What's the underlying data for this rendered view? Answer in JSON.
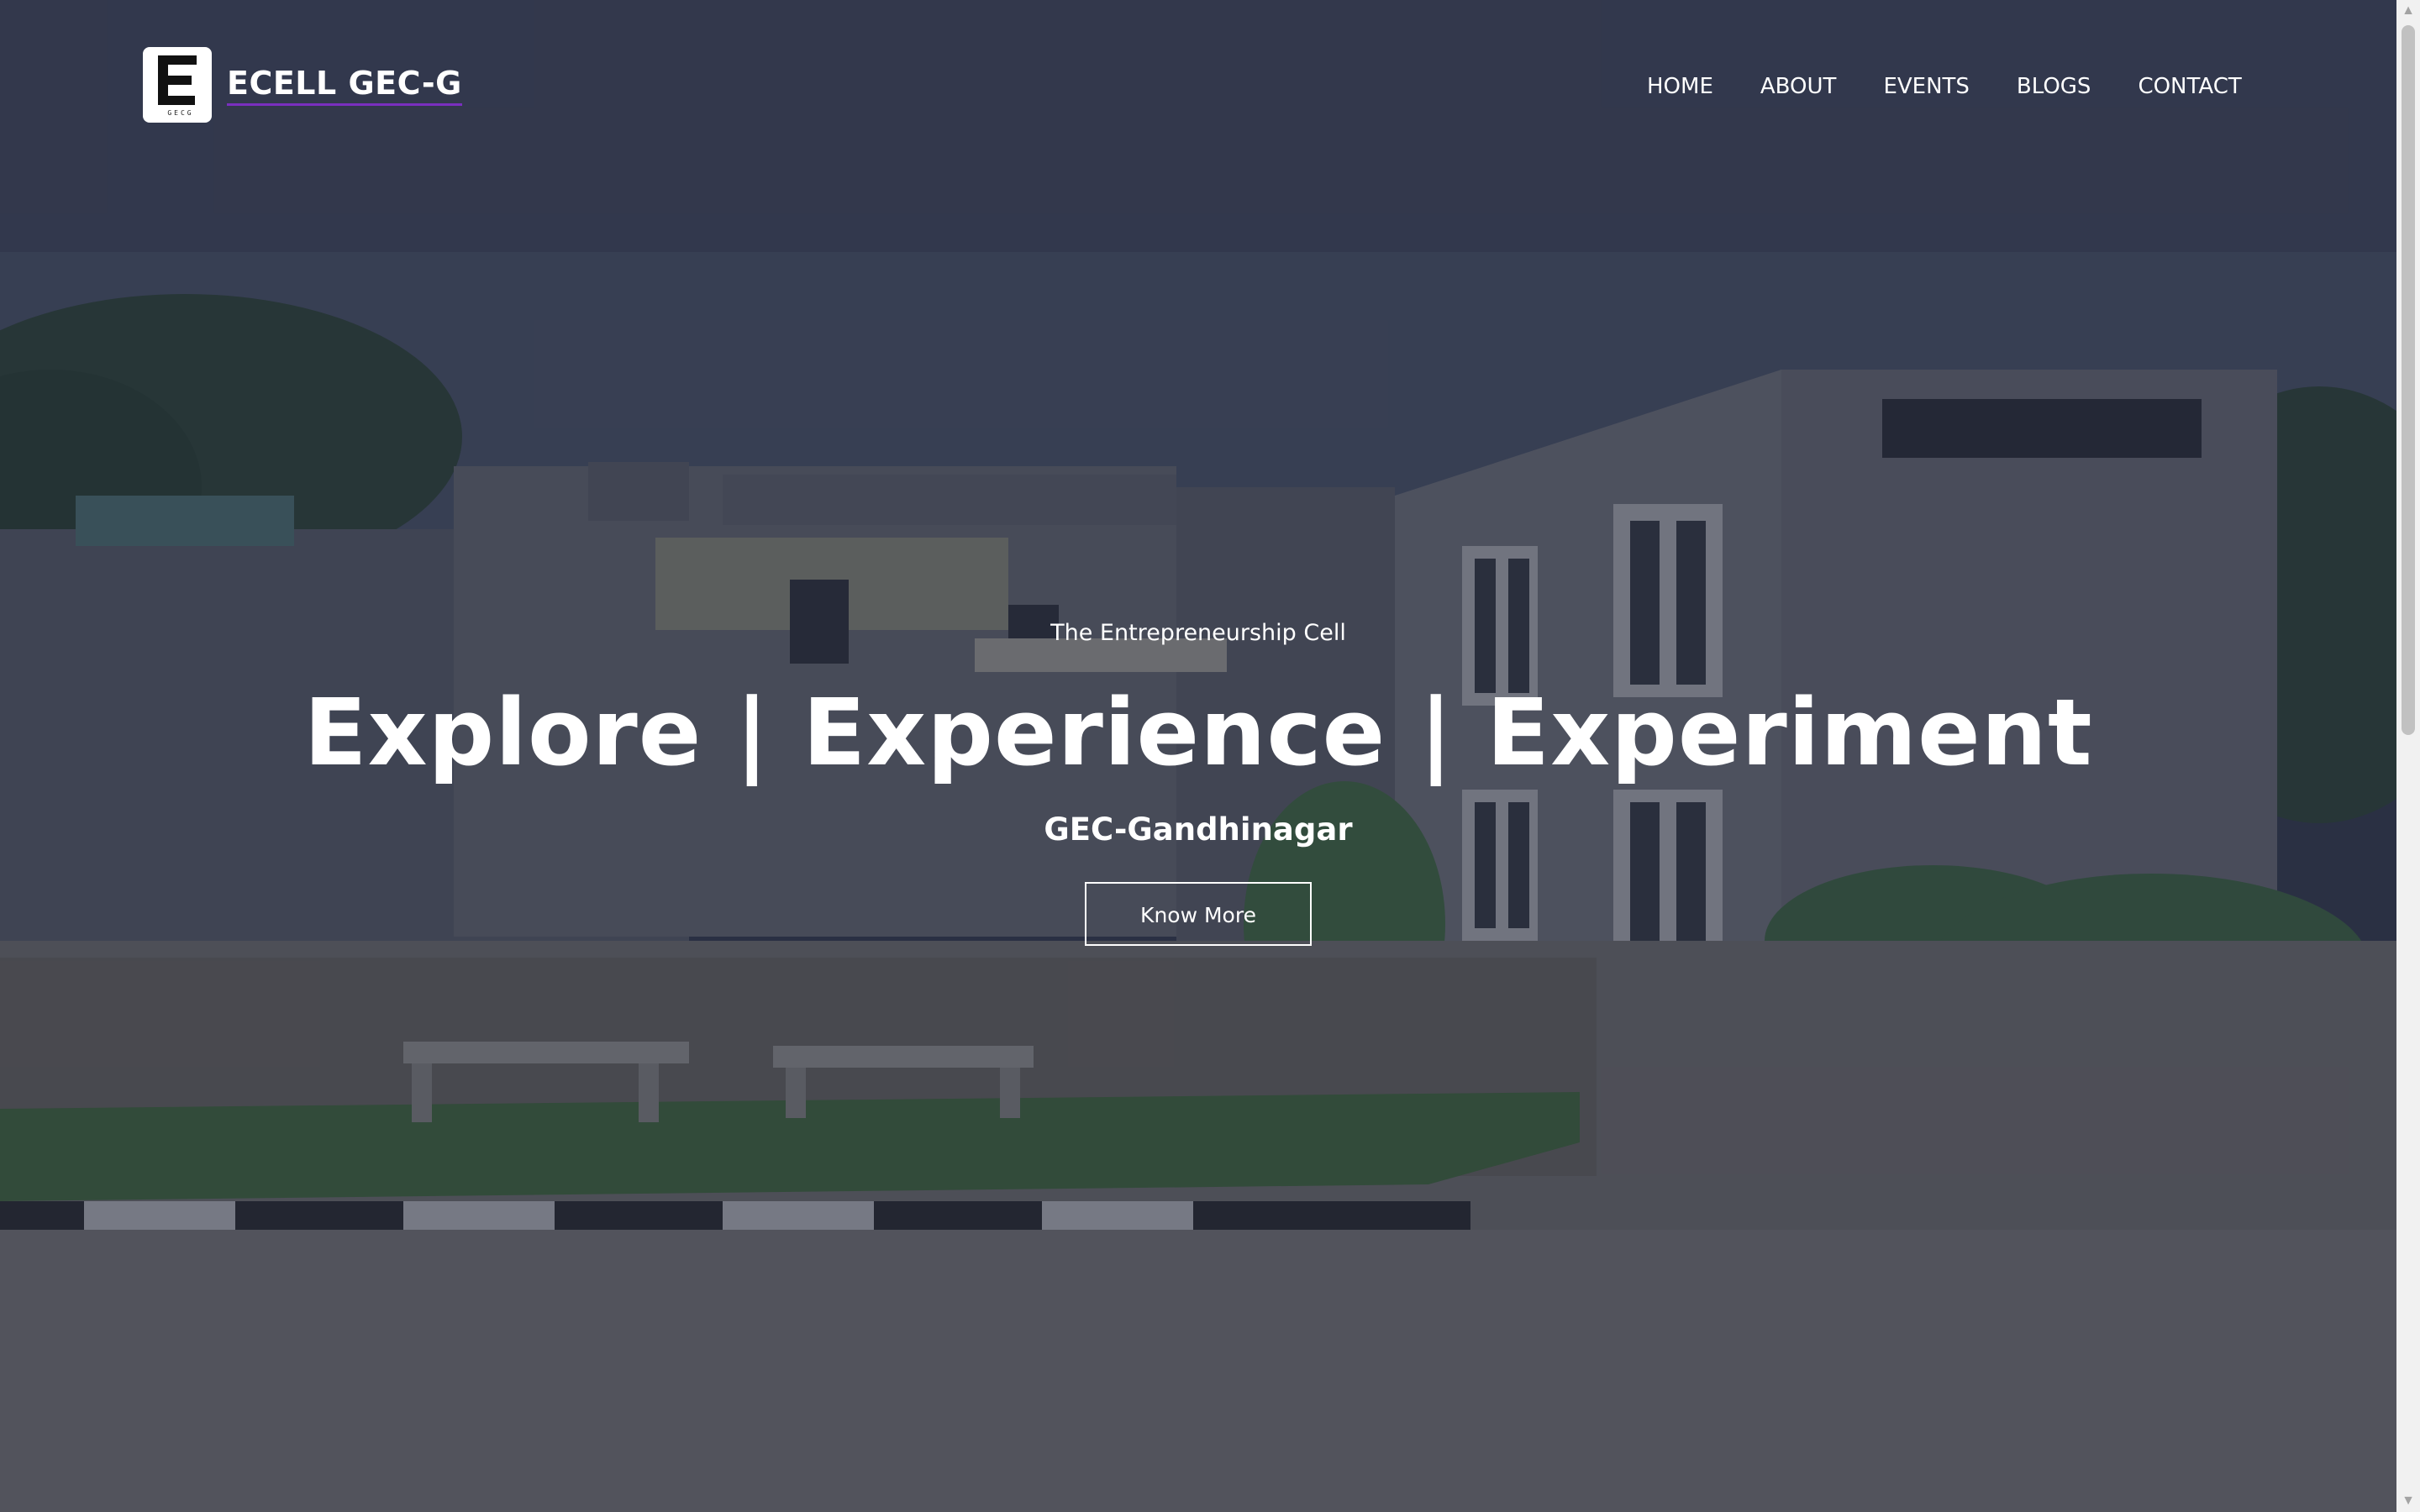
{
  "brand": {
    "name": "ECELL GEC-G",
    "logo_text": "GECG",
    "logo_icon": "ecell-logo-icon"
  },
  "nav": {
    "items": [
      {
        "label": "HOME"
      },
      {
        "label": "ABOUT"
      },
      {
        "label": "EVENTS"
      },
      {
        "label": "BLOGS"
      },
      {
        "label": "CONTACT"
      }
    ]
  },
  "hero": {
    "tagline": "The Entrepreneurship Cell",
    "title": "Explore | Experience | Experiment",
    "subtitle": "GEC-Gandhinagar",
    "button_label": "Know More",
    "background": "campus-building-photo"
  },
  "scrollbar": {
    "up_icon": "scroll-up-arrow-icon",
    "down_icon": "scroll-down-arrow-icon",
    "position_fraction": 0.0
  },
  "colors": {
    "overlay": "#1c2034",
    "text": "#ffffff",
    "brand_underline": "#7a2fbf"
  }
}
